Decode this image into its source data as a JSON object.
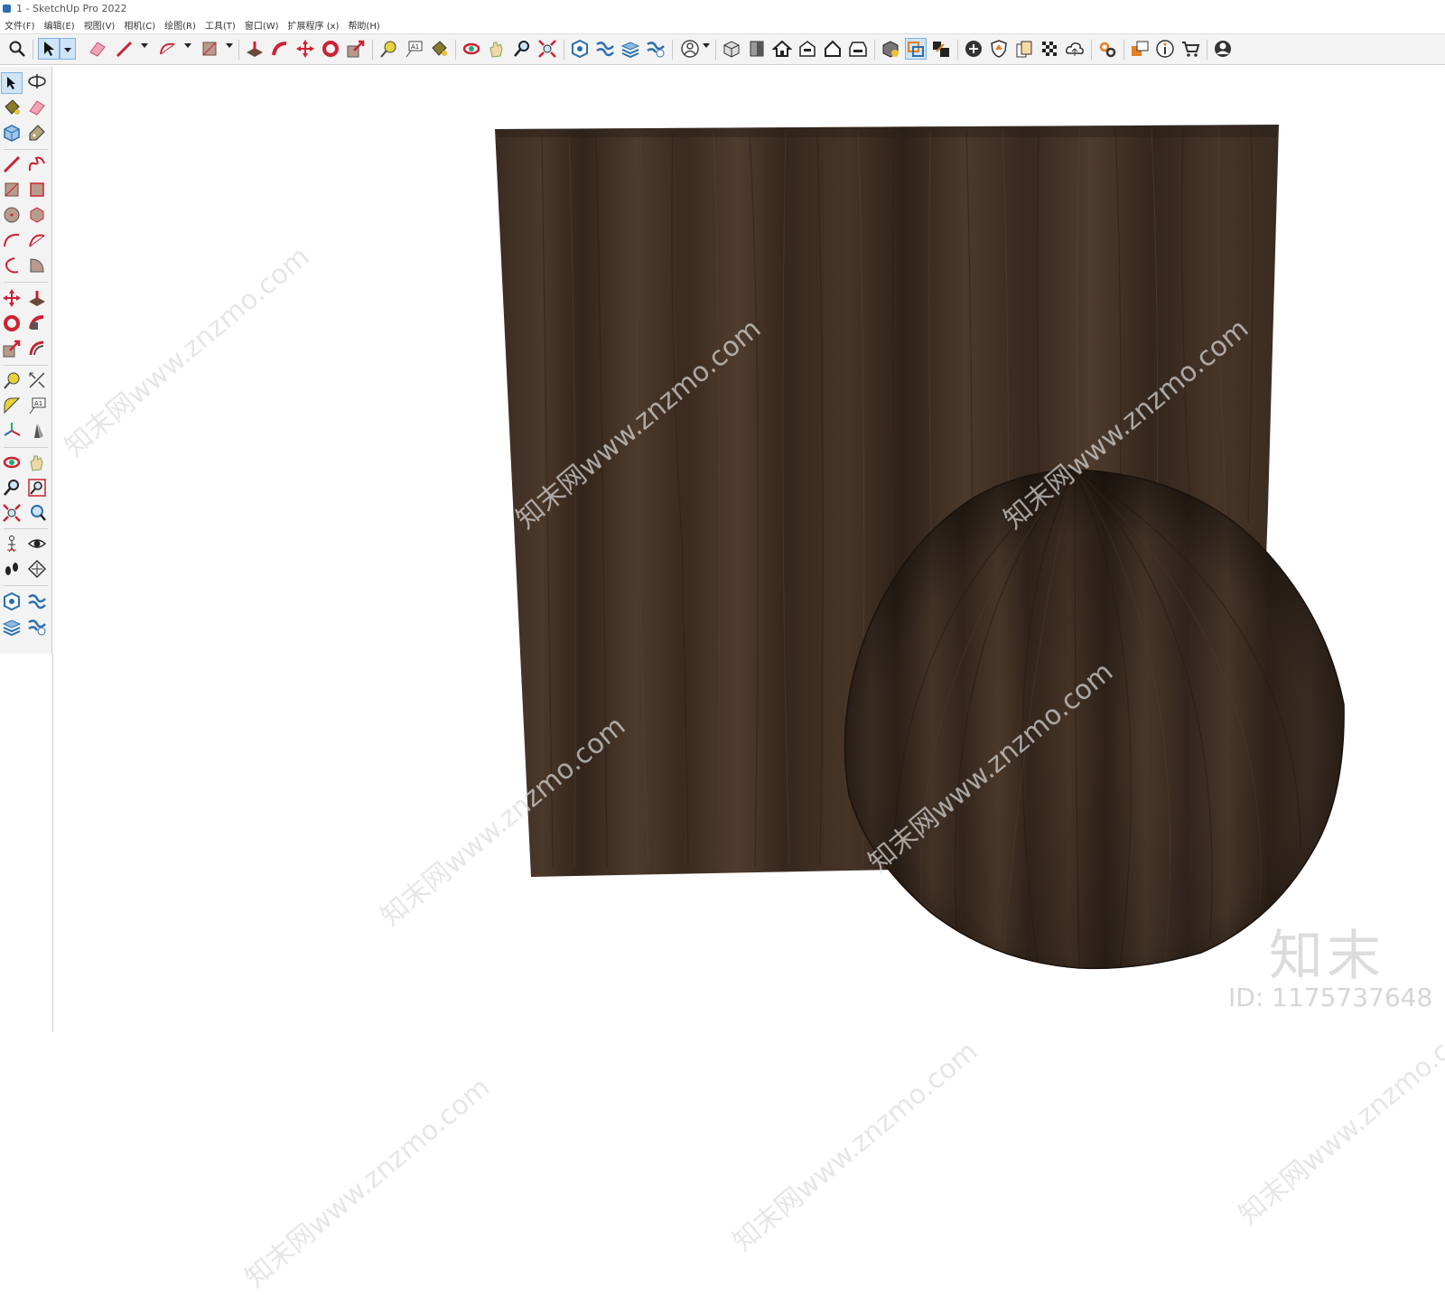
{
  "window": {
    "title": "1 - SketchUp Pro 2022"
  },
  "menubar": {
    "items": [
      "文件(F)",
      "编辑(E)",
      "视图(V)",
      "相机(C)",
      "绘图(R)",
      "工具(T)",
      "窗口(W)",
      "扩展程序 (x)",
      "帮助(H)"
    ]
  },
  "toolbar": {
    "icons": [
      "search-icon",
      "select-icon",
      "eraser-icon",
      "pencil-icon",
      "arc-icon",
      "rectangle-icon",
      "push-pull-icon",
      "follow-me-icon",
      "move-icon",
      "rotate-icon",
      "scale-icon",
      "tape-measure-icon",
      "text-icon",
      "paint-bucket-icon",
      "orbit-icon",
      "pan-icon",
      "zoom-icon",
      "zoom-extents-icon",
      "add-location-icon",
      "terrain-icon",
      "layers-icon",
      "sandbox-icon",
      "user-icon",
      "iso-view-icon",
      "front-view-icon",
      "top-home-icon",
      "house-view-icon",
      "home-outline-icon",
      "house-side-icon",
      "3d-warehouse-icon",
      "section-fill-icon",
      "section-cut-icon",
      "add-circle-icon",
      "shield-icon",
      "style-builder-icon",
      "checker-icon",
      "cloud-icon",
      "settings-icon",
      "dialog-icon",
      "info-icon",
      "cart-icon",
      "account-icon"
    ]
  },
  "left_toolbar": {
    "icons": [
      "select-icon",
      "orbit-icon",
      "paint-bucket-icon",
      "eraser-icon",
      "component-icon",
      "tag-icon",
      "line-icon",
      "freehand-icon",
      "rectangle-icon",
      "rotated-rectangle-icon",
      "circle-icon",
      "polygon-icon",
      "arc-icon",
      "two-point-arc-icon",
      "three-point-arc-icon",
      "pie-icon",
      "move-icon",
      "push-pull-icon",
      "rotate-icon",
      "follow-me-icon",
      "scale-icon",
      "offset-icon",
      "tape-measure-icon",
      "dimension-icon",
      "protractor-icon",
      "text-icon",
      "axes-icon",
      "3d-text-icon",
      "orbit-icon",
      "pan-icon",
      "zoom-icon",
      "zoom-window-icon",
      "zoom-extents-icon",
      "previous-view-icon",
      "position-camera-icon",
      "look-around-icon",
      "walk-icon",
      "section-plane-icon",
      "add-location-icon",
      "terrain-icon",
      "layers-icon",
      "sandbox-icon"
    ]
  },
  "watermark": {
    "brand": "知末",
    "id": "ID: 1175737648",
    "diagonal": "知末网www.znzmo.com"
  },
  "colors": {
    "wood_dark": "#3a2a1f",
    "wood_mid": "#4a3628",
    "wood_light": "#5a4433",
    "toolbar_bg": "#f3f3f3",
    "accent": "#cfe4f7"
  }
}
